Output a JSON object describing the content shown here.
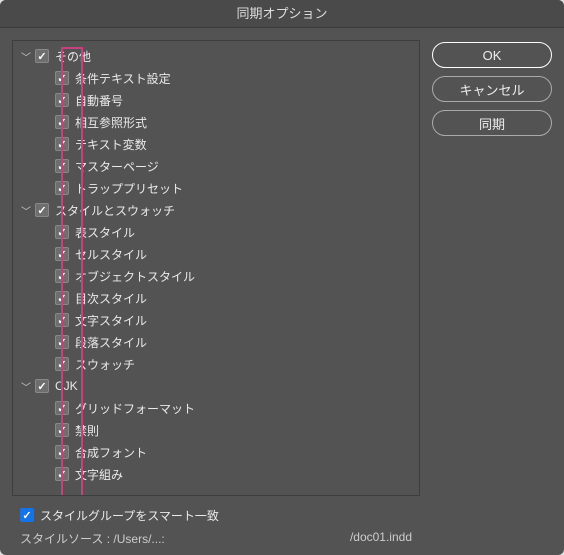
{
  "title": "同期オプション",
  "buttons": {
    "ok": "OK",
    "cancel": "キャンセル",
    "sync": "同期"
  },
  "tree": {
    "g0": {
      "label": "その他",
      "children": [
        "条件テキスト設定",
        "自動番号",
        "相互参照形式",
        "テキスト変数",
        "マスターページ",
        "トラッププリセット"
      ]
    },
    "g1": {
      "label": "スタイルとスウォッチ",
      "children": [
        "表スタイル",
        "セルスタイル",
        "オブジェクトスタイル",
        "目次スタイル",
        "文字スタイル",
        "段落スタイル",
        "スウォッチ"
      ]
    },
    "g2": {
      "label": "CJK",
      "children": [
        "グリッドフォーマット",
        "禁則",
        "合成フォント",
        "文字組み"
      ]
    }
  },
  "smart_match": "スタイルグループをスマート一致",
  "source_label": "スタイルソース :",
  "source_path": "/Users/...:",
  "source_file": "/doc01.indd"
}
